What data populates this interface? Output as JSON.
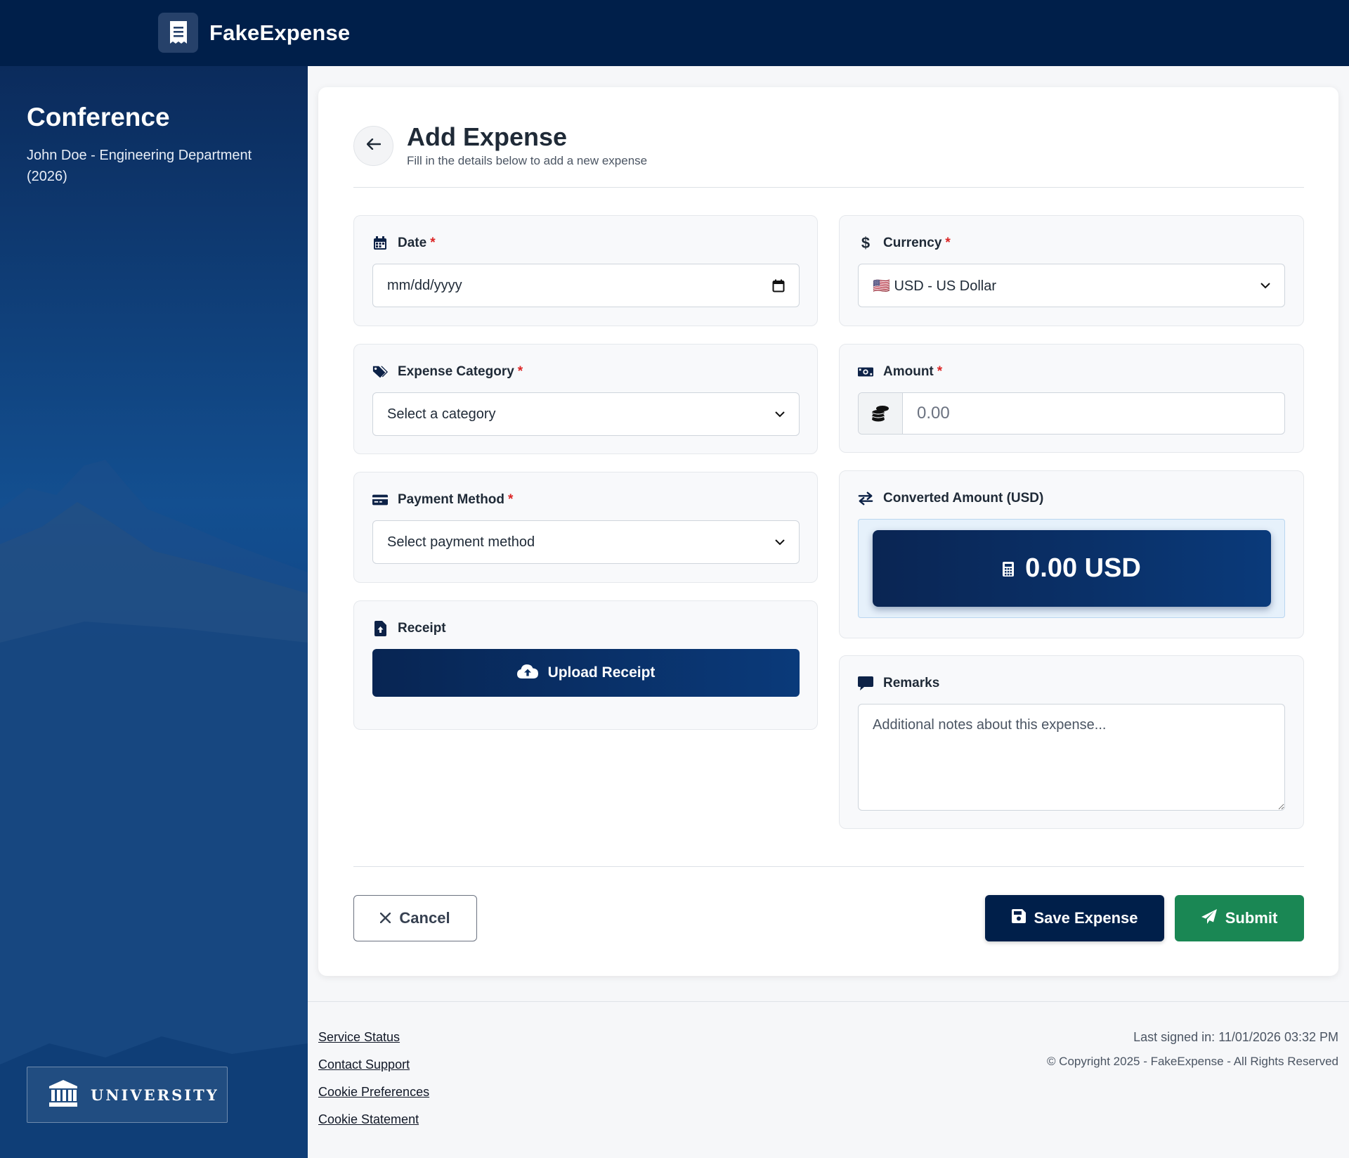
{
  "header": {
    "brand_name": "FakeExpense",
    "brand_icon": "receipt-icon"
  },
  "sidebar": {
    "title": "Conference",
    "subtitle": "John Doe - Engineering Department (2026)",
    "badge_label": "UNIVERSITY",
    "badge_icon": "university-icon"
  },
  "form": {
    "title": "Add Expense",
    "subtitle": "Fill in the details below to add a new expense",
    "required_mark": "*",
    "date": {
      "label": "Date",
      "placeholder": "mm/dd/yyyy",
      "icon": "calendar-icon"
    },
    "currency": {
      "label": "Currency",
      "value": "🇺🇸 USD - US Dollar",
      "icon": "dollar-icon"
    },
    "category": {
      "label": "Expense Category",
      "value": "Select a category",
      "icon": "tags-icon"
    },
    "amount": {
      "label": "Amount",
      "placeholder": "0.00",
      "icon": "money-bill-icon",
      "prefix_icon": "coins-icon"
    },
    "payment": {
      "label": "Payment Method",
      "value": "Select payment method",
      "icon": "credit-card-icon"
    },
    "converted": {
      "label": "Converted Amount (USD)",
      "value": "0.00 USD",
      "icon": "exchange-icon"
    },
    "receipt": {
      "label": "Receipt",
      "button": "Upload Receipt",
      "icon": "file-upload-icon"
    },
    "remarks": {
      "label": "Remarks",
      "placeholder": "Additional notes about this expense...",
      "icon": "comment-icon"
    }
  },
  "actions": {
    "cancel": "Cancel",
    "save": "Save Expense",
    "submit": "Submit"
  },
  "footer": {
    "links": [
      "Service Status",
      "Contact Support",
      "Cookie Preferences",
      "Cookie Statement"
    ],
    "last_signed": "Last signed in: 11/01/2026 03:32 PM",
    "copyright": "© Copyright 2025 - FakeExpense - All Rights Reserved"
  },
  "colors": {
    "navy": "#001f4a",
    "green": "#1a8754",
    "required": "#dc2626"
  }
}
